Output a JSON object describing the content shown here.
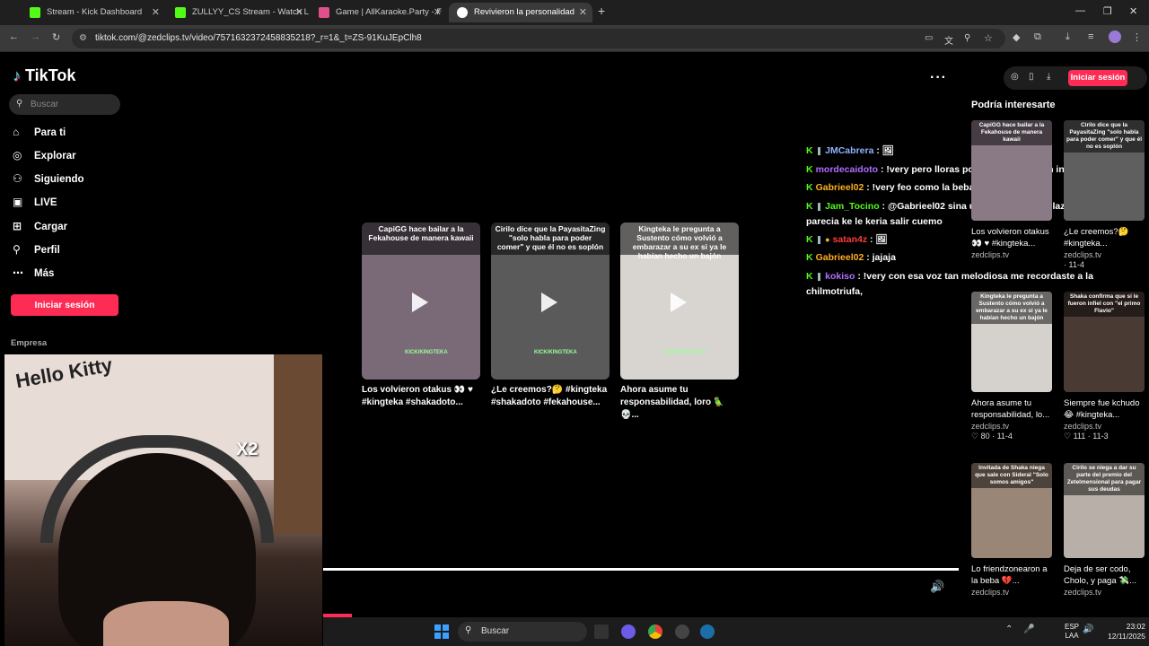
{
  "browser": {
    "tabs": [
      {
        "title": "Stream - Kick Dashboard",
        "favicon_color": "#53fc18"
      },
      {
        "title": "ZULLYY_CS Stream - Watch Live",
        "favicon_color": "#53fc18"
      },
      {
        "title": "Game | AllKaraoke.Party - F",
        "favicon_color": "#e0508a"
      },
      {
        "title": "Revivieron la personalidad",
        "favicon_color": "#ffffff",
        "active": true
      }
    ],
    "new_tab": "+",
    "url": "tiktok.com/@zedclips.tv/video/7571632372458835218?_r=1&_t=ZS-91KuJEpClh8"
  },
  "tiktok": {
    "logo": "TikTok",
    "search_placeholder": "Buscar",
    "nav": [
      {
        "label": "Para ti",
        "icon": "home-icon",
        "glyph": "⌂"
      },
      {
        "label": "Explorar",
        "icon": "compass-icon",
        "glyph": "◎"
      },
      {
        "label": "Siguiendo",
        "icon": "following-icon",
        "glyph": "⚇"
      },
      {
        "label": "LIVE",
        "icon": "live-icon",
        "glyph": "▣"
      },
      {
        "label": "Cargar",
        "icon": "upload-icon",
        "glyph": "⊞"
      },
      {
        "label": "Perfil",
        "icon": "profile-icon",
        "glyph": "⚲"
      },
      {
        "label": "Más",
        "icon": "more-icon",
        "glyph": "⋯"
      }
    ],
    "login_button": "Iniciar sesión",
    "section_empresa": "Empresa",
    "top_signin": "Iniciar sesión",
    "webcam_overlay": {
      "sticker_text": "Hello Kitty",
      "multiplier": "X2"
    },
    "video_cards": [
      {
        "header": "CapiGG hace bailar a la Fekahouse de manera kawaii",
        "caption": "Los volvieron otakus 👀 ♥ #kingteka #shakadoto...",
        "watermark": "KICK/KINGTEKA",
        "bg": "#7a6a78"
      },
      {
        "header": "Cirilo dice que la PayasitaZing \"solo habla para poder comer\" y que él no es soplón",
        "caption": "¿Le creemos?🤔 #kingteka #shakadoto #fekahouse...",
        "watermark": "KICK/KINGTEKA",
        "bg": "#5a5a5a"
      },
      {
        "header": "Kingteka le pregunta a Sustento cómo volvió a embarazar a su ex si ya le habían hecho un bajón",
        "caption": "Ahora asume tu responsabilidad, loro 🦜 💀...",
        "watermark": "KICK/KINGTEKA",
        "bg": "#d8d4d0"
      }
    ],
    "chat": [
      {
        "user": "JMCabrera",
        "color": "#8fb3ff",
        "msg": "🖼"
      },
      {
        "user": "mordecaidoto",
        "color": "#b26dff",
        "msg": "!very pero lloras por todo, no es gran indicador"
      },
      {
        "user": "Gabrieel02",
        "color": "#ffb020",
        "msg": "!very feo como la beba o feo como verte"
      },
      {
        "user": "Jam_Tocino",
        "color": "#53fc18",
        "msg": "@Gabrieel02 sina uno le dejo una bolaza en la cabeza"
      },
      {
        "user": "",
        "color": "#ffffff",
        "msg": "parecia ke le keria salir cuemo"
      },
      {
        "user": "satan4z",
        "color": "#ff3b3b",
        "msg": "🖼"
      },
      {
        "user": "Gabrieel02",
        "color": "#ffb020",
        "msg": "jajaja"
      },
      {
        "user": "kokiso",
        "color": "#b26dff",
        "msg": "!very con esa voz tan melodiosa me recordaste a la"
      },
      {
        "user": "",
        "color": "#ffffff",
        "msg": "chilmotriufa,"
      }
    ],
    "recommended_title": "Podría interesarte",
    "recommended": [
      {
        "header": "CapiGG hace bailar a la Fekahouse de manera kawaii",
        "title": "Los volvieron otakus 👀 ♥ #kingteka...",
        "source": "zedclips.tv",
        "stats": "",
        "bg": "#8a7a86"
      },
      {
        "header": "Cirilo dice que la PayasitaZing \"solo habla para poder comer\" y que él no es soplón",
        "title": "¿Le creemos?🤔 #kingteka...",
        "source": "zedclips.tv",
        "stats": "· 11-4",
        "bg": "#5f5f5f"
      },
      {
        "header": "Kingteka le pregunta a Sustento cómo volvió a embarazar a su ex si ya le habían hecho un bajón",
        "title": "Ahora asume tu responsabilidad, lo...",
        "source": "zedclips.tv",
        "stats": "♡ 80 · 11-4",
        "bg": "#d5d1cd"
      },
      {
        "header": "Shaka confirma que si le fueron infiel con \"el primo Flavio\"",
        "title": "Siempre fue kchudo 😂 #kingteka...",
        "source": "zedclips.tv",
        "stats": "♡ 111 · 11-3",
        "bg": "#4a3a34"
      },
      {
        "header": "Invitada de Shaka niega que sale con Sideral \"Solo somos amigos\"",
        "title": "Lo friendzonearon a la beba 💔...",
        "source": "zedclips.tv",
        "stats": "",
        "bg": "#9a8676"
      },
      {
        "header": "Cirilo se niega a dar su parte del premio del Zetelmensional para pagar sus deudas",
        "title": "Deja de ser codo, Cholo, y paga 💸...",
        "source": "zedclips.tv",
        "stats": "",
        "bg": "#b8b0a8"
      }
    ]
  },
  "taskbar": {
    "search_placeholder": "Buscar",
    "lang_top": "ESP",
    "lang_bottom": "LAA",
    "time": "23:02",
    "date": "12/11/2025"
  }
}
